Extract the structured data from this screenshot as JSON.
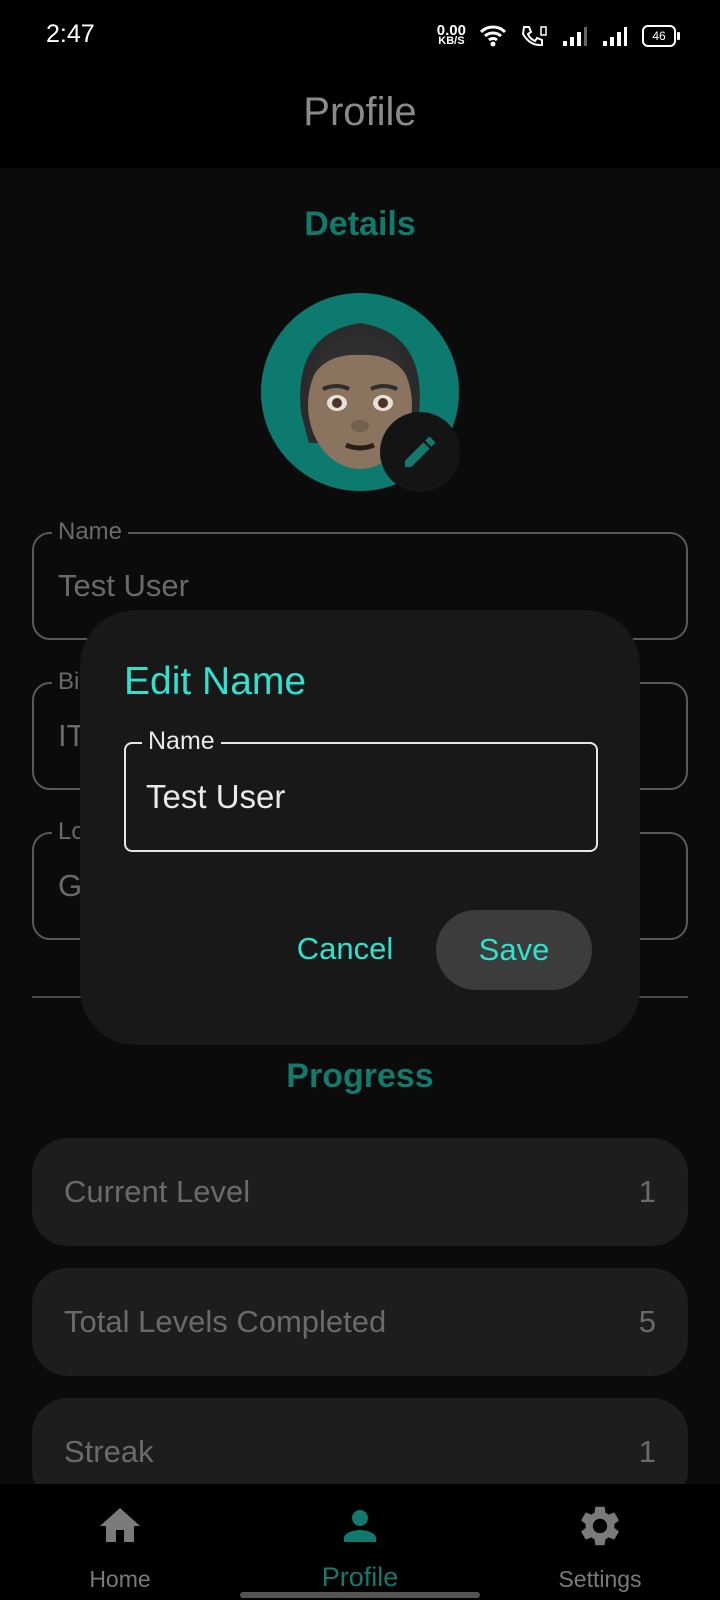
{
  "status_bar": {
    "time": "2:47",
    "net_speed_value": "0.00",
    "net_speed_unit": "KB/S",
    "battery_level": "46"
  },
  "header": {
    "title": "Profile"
  },
  "details": {
    "section_title": "Details",
    "fields": [
      {
        "label": "Name",
        "value": "Test User"
      },
      {
        "label": "Bi",
        "value": "IT"
      },
      {
        "label": "Lo",
        "value": "G"
      }
    ]
  },
  "progress": {
    "section_title": "Progress",
    "stats": [
      {
        "label": "Current Level",
        "value": "1"
      },
      {
        "label": "Total Levels Completed",
        "value": "5"
      },
      {
        "label": "Streak",
        "value": "1"
      }
    ]
  },
  "dialog": {
    "title": "Edit Name",
    "field_label": "Name",
    "field_value": "Test User",
    "cancel_label": "Cancel",
    "save_label": "Save"
  },
  "bottom_nav": {
    "items": [
      {
        "label": "Home",
        "icon": "home-icon",
        "active": false
      },
      {
        "label": "Profile",
        "icon": "person-icon",
        "active": true
      },
      {
        "label": "Settings",
        "icon": "gear-icon",
        "active": false
      }
    ]
  },
  "colors": {
    "accent": "#2de3d0",
    "accent_dim": "#117a6c",
    "dialog_bg": "#181818",
    "background": "#0b0b0b"
  }
}
